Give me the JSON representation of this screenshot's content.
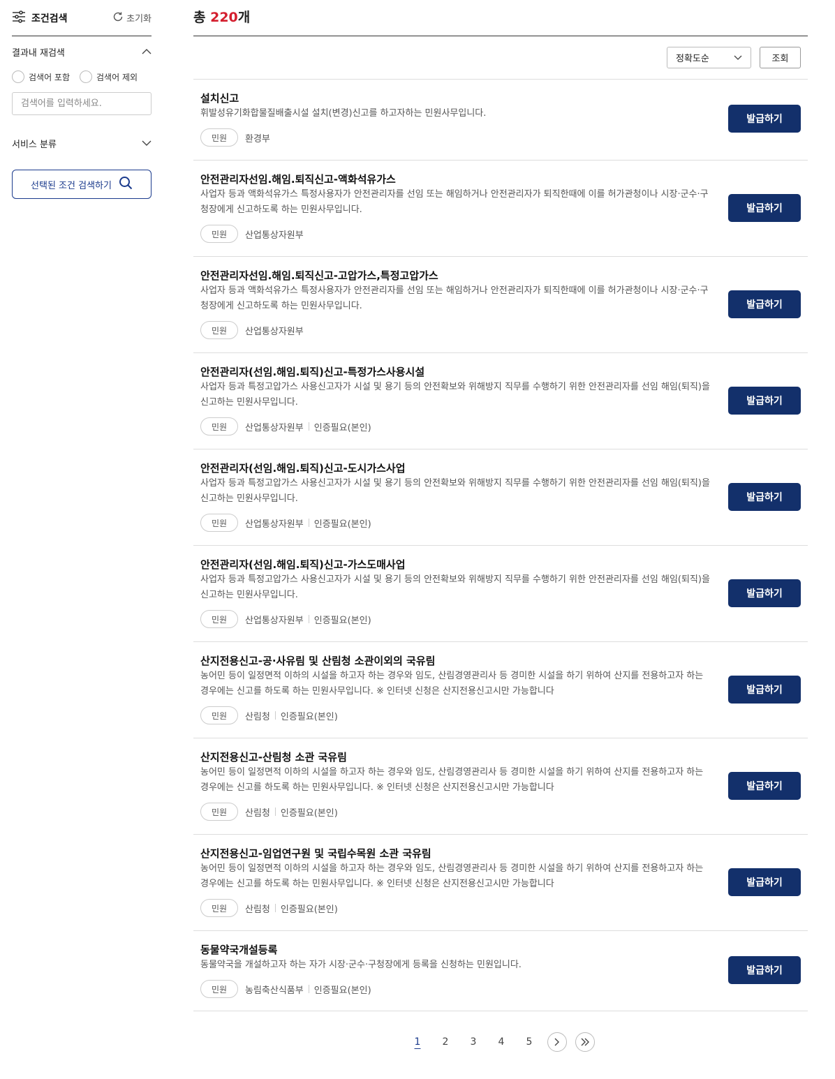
{
  "sidebar": {
    "title": "조건검색",
    "reset_label": "초기화",
    "research_label": "결과내 재검색",
    "radio_include": "검색어 포함",
    "radio_exclude": "검색어 제외",
    "search_placeholder": "검색어를 입력하세요.",
    "category_label": "서비스 분류",
    "search_button": "선택된 조건 검색하기"
  },
  "header": {
    "total_prefix": "총 ",
    "total_count": "220",
    "total_suffix": "개"
  },
  "toolbar": {
    "sort_value": "정확도순",
    "query_button": "조회"
  },
  "issue_label": "발급하기",
  "items": [
    {
      "title": "설치신고",
      "desc": "휘발성유기화합물질배출시설 설치(변경)신고를 하고자하는 민원사무입니다.",
      "badge": "민원",
      "agency": "환경부",
      "auth": ""
    },
    {
      "title": "안전관리자선임.해임.퇴직신고-액화석유가스",
      "desc": "사업자 등과 액화석유가스 특정사용자가 안전관리자를 선임 또는 해임하거나 안전관리자가 퇴직한때에 이를 허가관청이나 시장·군수·구청장에게 신고하도록 하는 민원사무입니다.",
      "badge": "민원",
      "agency": "산업통상자원부",
      "auth": ""
    },
    {
      "title": "안전관리자선임.해임.퇴직신고-고압가스,특정고압가스",
      "desc": "사업자 등과 액화석유가스 특정사용자가 안전관리자를 선임 또는 해임하거나 안전관리자가 퇴직한때에 이를 허가관청이나 시장·군수·구청장에게 신고하도록 하는 민원사무입니다.",
      "badge": "민원",
      "agency": "산업통상자원부",
      "auth": ""
    },
    {
      "title": "안전관리자(선임.해임.퇴직)신고-특정가스사용시설",
      "desc": "사업자 등과 특정고압가스 사용신고자가 시설 및 용기 등의 안전확보와 위해방지 직무를 수행하기 위한 안전관리자를 선임 해임(퇴직)을 신고하는 민원사무입니다.",
      "badge": "민원",
      "agency": "산업통상자원부",
      "auth": "인증필요(본인)"
    },
    {
      "title": "안전관리자(선임.해임.퇴직)신고-도시가스사업",
      "desc": "사업자 등과 특정고압가스 사용신고자가 시설 및 용기 등의 안전확보와 위해방지 직무를 수행하기 위한 안전관리자를 선임 해임(퇴직)을 신고하는 민원사무입니다.",
      "badge": "민원",
      "agency": "산업통상자원부",
      "auth": "인증필요(본인)"
    },
    {
      "title": "안전관리자(선임.해임.퇴직)신고-가스도매사업",
      "desc": "사업자 등과 특정고압가스 사용신고자가 시설 및 용기 등의 안전확보와 위해방지 직무를 수행하기 위한 안전관리자를 선임 해임(퇴직)을 신고하는 민원사무입니다.",
      "badge": "민원",
      "agency": "산업통상자원부",
      "auth": "인증필요(본인)"
    },
    {
      "title": "산지전용신고-공·사유림 및 산림청 소관이외의 국유림",
      "desc": "농어민 등이 일정면적 이하의 시설을 하고자 하는 경우와 임도, 산림경영관리사 등 경미한 시설을 하기 위하여 산지를 전용하고자 하는 경우에는 신고를 하도록 하는 민원사무입니다. ※ 인터넷 신청은 산지전용신고시만 가능합니다",
      "badge": "민원",
      "agency": "산림청",
      "auth": "인증필요(본인)"
    },
    {
      "title": "산지전용신고-산림청 소관 국유림",
      "desc": "농어민 등이 일정면적 이하의 시설을 하고자 하는 경우와 임도, 산림경영관리사 등 경미한 시설을 하기 위하여 산지를 전용하고자 하는 경우에는 신고를 하도록 하는 민원사무입니다. ※ 인터넷 신청은 산지전용신고시만 가능합니다",
      "badge": "민원",
      "agency": "산림청",
      "auth": "인증필요(본인)"
    },
    {
      "title": "산지전용신고-임업연구원 및 국립수목원 소관 국유림",
      "desc": "농어민 등이 일정면적 이하의 시설을 하고자 하는 경우와 임도, 산림경영관리사 등 경미한 시설을 하기 위하여 산지를 전용하고자 하는 경우에는 신고를 하도록 하는 민원사무입니다. ※ 인터넷 신청은 산지전용신고시만 가능합니다",
      "badge": "민원",
      "agency": "산림청",
      "auth": "인증필요(본인)"
    },
    {
      "title": "동물약국개설등록",
      "desc": "동물약국을 개설하고자 하는 자가 시장·군수·구청장에게 등록을 신청하는 민원입니다.",
      "badge": "민원",
      "agency": "농림축산식품부",
      "auth": "인증필요(본인)"
    }
  ],
  "pagination": {
    "pages": [
      "1",
      "2",
      "3",
      "4",
      "5"
    ],
    "current": "1"
  }
}
